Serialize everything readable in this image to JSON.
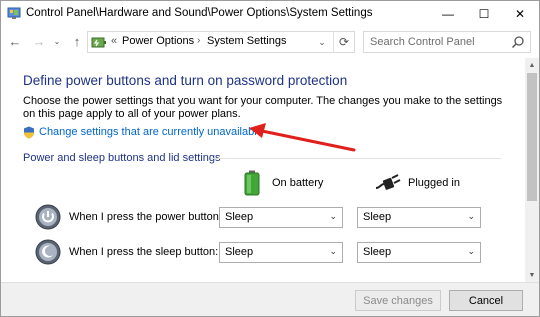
{
  "window": {
    "title": "Control Panel\\Hardware and Sound\\Power Options\\System Settings",
    "minimize_glyph": "—",
    "maximize_glyph": "☐",
    "close_glyph": "✕"
  },
  "nav": {
    "back_glyph": "←",
    "forward_glyph": "→",
    "recent_glyph": "⌄",
    "up_glyph": "↑"
  },
  "address": {
    "chevron": "«",
    "crumbs": [
      "Power Options",
      "System Settings"
    ],
    "separator": "›",
    "dropdown_glyph": "⌄",
    "refresh_glyph": "⟳"
  },
  "search": {
    "placeholder": "Search Control Panel",
    "icon": "search-icon"
  },
  "main": {
    "heading": "Define power buttons and turn on password protection",
    "description": "Choose the power settings that you want for your computer. The changes you make to the settings on this page apply to all of your power plans.",
    "change_link": "Change settings that are currently unavailable",
    "section_title": "Power and sleep buttons and lid settings",
    "columns": {
      "battery": "On battery",
      "plugged": "Plugged in"
    },
    "rows": [
      {
        "label": "When I press the power button:",
        "battery": "Sleep",
        "plugged": "Sleep",
        "icon": "power-button-icon"
      },
      {
        "label": "When I press the sleep button:",
        "battery": "Sleep",
        "plugged": "Sleep",
        "icon": "sleep-button-icon"
      }
    ],
    "select_chevron": "⌄"
  },
  "scrollbar": {
    "up_glyph": "▲",
    "down_glyph": "▼"
  },
  "footer": {
    "save_label": "Save changes",
    "cancel_label": "Cancel"
  },
  "colors": {
    "heading": "#1e3287",
    "link": "#0066cc",
    "annotation_arrow": "#e0201c"
  }
}
